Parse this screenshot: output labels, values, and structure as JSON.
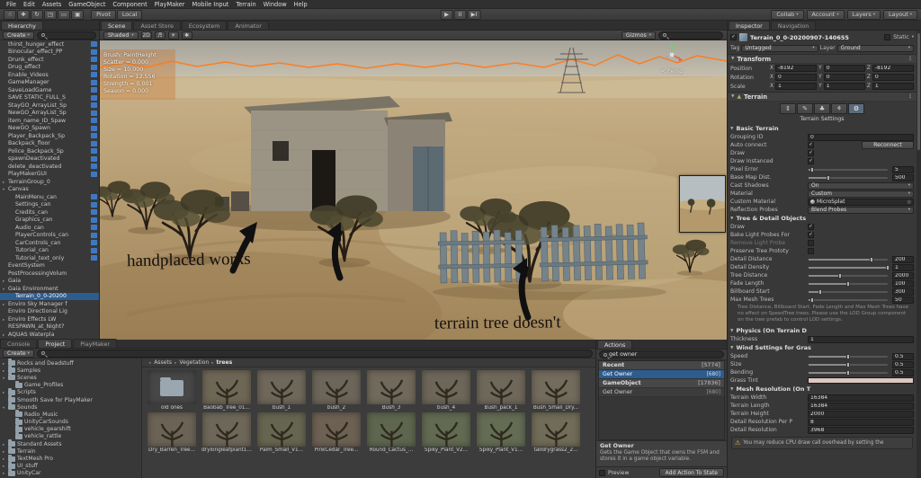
{
  "colors": {
    "selection": "#2d5c8f",
    "badge": "#3d77c2",
    "outline": "#ff7a1c",
    "annotation": "#14110d"
  },
  "menubar": {
    "items": [
      "File",
      "Edit",
      "Assets",
      "GameObject",
      "Component",
      "PlayMaker",
      "Mobile Input",
      "Terrain",
      "Window",
      "Help"
    ]
  },
  "toolbar": {
    "tools": [
      {
        "name": "hand-tool-icon",
        "glyph": "☝"
      },
      {
        "name": "move-tool-icon",
        "glyph": "✚"
      },
      {
        "name": "rotate-tool-icon",
        "glyph": "↻"
      },
      {
        "name": "scale-tool-icon",
        "glyph": "◳"
      },
      {
        "name": "rect-tool-icon",
        "glyph": "▭"
      },
      {
        "name": "transform-tool-icon",
        "glyph": "▣"
      }
    ],
    "pivot": "Pivot",
    "local": "Local",
    "play": "▶",
    "pause": "II",
    "step": "▶I",
    "right": [
      {
        "name": "collab-dropdown",
        "label": "Collab"
      },
      {
        "name": "account-dropdown",
        "label": "Account"
      },
      {
        "name": "layers-dropdown",
        "label": "Layers"
      },
      {
        "name": "layout-dropdown",
        "label": "Layout"
      }
    ]
  },
  "hierarchy": {
    "tab": "Hierarchy",
    "create_label": "Create",
    "items": [
      {
        "label": "thirst_hunger_effect",
        "badge": true
      },
      {
        "label": "Binocular_effect_PP",
        "badge": true
      },
      {
        "label": "Drunk_effect",
        "badge": true
      },
      {
        "label": "Drug_effect",
        "badge": true
      },
      {
        "label": "Enable_Videos",
        "badge": true
      },
      {
        "label": "GameManager",
        "badge": true
      },
      {
        "label": "SaveLoadGame",
        "badge": true
      },
      {
        "label": "SAVE STATIC_FULL_S",
        "badge": true
      },
      {
        "label": "StayGO_ArrayList_Sp",
        "badge": true
      },
      {
        "label": "NewGO_ArrayList_Sp",
        "badge": true
      },
      {
        "label": "item_name_ID_Spaw",
        "badge": true
      },
      {
        "label": "NewGO_Spawn",
        "badge": true
      },
      {
        "label": "Player_Backpack_Sp",
        "badge": true
      },
      {
        "label": "Backpack_floor",
        "badge": true
      },
      {
        "label": "Police_Backpack_Sp",
        "badge": true
      },
      {
        "label": "spawnDeactivated",
        "badge": true
      },
      {
        "label": "delete_deactivated",
        "badge": true
      },
      {
        "label": "PlayMakerGUI",
        "badge": true
      },
      {
        "label": "TerrainGroup_0",
        "arrow": "▸"
      },
      {
        "label": "Canvas",
        "arrow": "▾"
      },
      {
        "label": "MainMenu_can",
        "indent": 1,
        "badge": true
      },
      {
        "label": "Settings_can",
        "indent": 1,
        "badge": true
      },
      {
        "label": "Credits_can",
        "indent": 1,
        "badge": true
      },
      {
        "label": "Graphics_can",
        "indent": 1,
        "badge": true
      },
      {
        "label": "Audio_can",
        "indent": 1,
        "badge": true
      },
      {
        "label": "PlayerControls_can",
        "indent": 1,
        "badge": true
      },
      {
        "label": "CarControls_can",
        "indent": 1,
        "badge": true
      },
      {
        "label": "Tutorial_can",
        "indent": 1,
        "badge": true
      },
      {
        "label": "Tutorial_text_only",
        "indent": 1,
        "badge": true
      },
      {
        "label": "EventSystem"
      },
      {
        "label": "PostProcessingVolum"
      },
      {
        "label": "Gaia",
        "arrow": "▸"
      },
      {
        "label": "Gaia Environment",
        "arrow": "▾"
      },
      {
        "label": "Terrain_0_0-20200",
        "indent": 1,
        "selected": true
      },
      {
        "label": "Enviro Sky Manager f",
        "arrow": "▸"
      },
      {
        "label": "Enviro Directional Lig"
      },
      {
        "label": "Enviro Effects LW",
        "arrow": "▸"
      },
      {
        "label": "RESPAWN_at_Night?"
      },
      {
        "label": "AQUAS Waterpla",
        "arrow": "▸"
      }
    ]
  },
  "scene": {
    "tabs": [
      {
        "name": "tab-scene",
        "label": "Scene",
        "active": true
      },
      {
        "name": "tab-asset-store",
        "label": "Asset Store"
      },
      {
        "name": "tab-ecosystem",
        "label": "Ecosystem"
      },
      {
        "name": "tab-animator",
        "label": "Animator"
      }
    ],
    "shading": "Shaded",
    "d2": "2D",
    "audio_icon": "♬",
    "light_icon": "☀",
    "fx_icon": "✱",
    "gizmos": "Gizmos",
    "brush_lines": [
      "Brush: PaintHeight",
      "Scatter = 0.000",
      "Size = 10.000",
      "Rotation = 12.556",
      "Strength = 0.001",
      "Season = 0.000"
    ],
    "annotation_left": "handplaced works",
    "annotation_right": "terrain tree doesn't",
    "persp_label": "< Persp"
  },
  "bottom_tabs": [
    {
      "name": "tab-console",
      "label": "Console"
    },
    {
      "name": "tab-project",
      "label": "Project",
      "active": true
    },
    {
      "name": "tab-playmaker",
      "label": "PlayMaker"
    }
  ],
  "project": {
    "create_label": "Create",
    "tree": [
      {
        "label": "Rocks and Deadstuff",
        "arrow": "▸"
      },
      {
        "label": "Samples",
        "arrow": "▸"
      },
      {
        "label": "Scenes",
        "arrow": "▾"
      },
      {
        "label": "Game_Profiles",
        "indent": 1
      },
      {
        "label": "Scripts",
        "arrow": "▸"
      },
      {
        "label": "Smooth Save for PlayMaker"
      },
      {
        "label": "Sounds",
        "arrow": "▾"
      },
      {
        "label": "Radio_Music",
        "indent": 1
      },
      {
        "label": "UnityCarSounds",
        "indent": 1
      },
      {
        "label": "vehicle_gearshift",
        "indent": 1
      },
      {
        "label": "vehicle_rattle",
        "indent": 1
      },
      {
        "label": "Standard Assets",
        "arrow": "▸"
      },
      {
        "label": "Terrain",
        "arrow": "▸"
      },
      {
        "label": "TextMesh Pro",
        "arrow": "▸"
      },
      {
        "label": "UI_stuff",
        "arrow": "▸"
      },
      {
        "label": "UnityCar",
        "arrow": "▸"
      }
    ],
    "breadcrumb": [
      "Assets",
      "Vegetation",
      "trees"
    ],
    "items": [
      {
        "label": "old ones",
        "folder": true,
        "tint": "#474747"
      },
      {
        "label": "Baobab_Tree_01...",
        "tint": "#6f6756"
      },
      {
        "label": "bush_1",
        "tint": "#6e675a"
      },
      {
        "label": "bush_2",
        "tint": "#6c655a"
      },
      {
        "label": "Bush_3",
        "tint": "#71695b"
      },
      {
        "label": "bush_4",
        "tint": "#6d6659"
      },
      {
        "label": "Bush_pack_1",
        "tint": "#6f685a"
      },
      {
        "label": "Bush_Small_Dry...",
        "tint": "#736b5c"
      },
      {
        "label": "Dry_Barren_Tree...",
        "tint": "#6b6355"
      },
      {
        "label": "drylongleafplant1...",
        "tint": "#6e6759"
      },
      {
        "label": "Palm_Small_V1...",
        "tint": "#666550"
      },
      {
        "label": "PinkCedar_Tree...",
        "tint": "#6d6153"
      },
      {
        "label": "Round_Cactus_...",
        "tint": "#5e6650"
      },
      {
        "label": "Spiky_Plant_V2...",
        "tint": "#626a52"
      },
      {
        "label": "Spiky_Plant_V1...",
        "tint": "#646c54"
      },
      {
        "label": "talldrygrass2_2...",
        "tint": "#706c57"
      }
    ]
  },
  "actions": {
    "tab": "Actions",
    "search_value": "get owner",
    "rows": [
      {
        "label": "Recent",
        "count": "[5774]",
        "header": true
      },
      {
        "label": "Get Owner",
        "count": "[680]",
        "selected": true
      },
      {
        "label": "GameObject",
        "count": "[17836]",
        "header": true
      },
      {
        "label": "Get Owner",
        "count": "[680]"
      }
    ],
    "desc_title": "Get Owner",
    "desc_body": "Gets the Game Object that owns the FSM and stores it in a game object variable.",
    "preview_label": "Preview",
    "add_button": "Add Action To State"
  },
  "inspector": {
    "tabs": [
      {
        "name": "tab-inspector",
        "label": "Inspector",
        "active": true
      },
      {
        "name": "tab-navigation",
        "label": "Navigation"
      }
    ],
    "header": {
      "name": "Terrain_0_0-20200907-140655",
      "static_label": "Static",
      "tag_label": "Tag",
      "tag": "Untagged",
      "layer_label": "Layer",
      "layer": "Ground"
    },
    "transform": {
      "title": "Transform",
      "axes": [
        "X",
        "Y",
        "Z"
      ],
      "rows": [
        {
          "label": "Position",
          "x": "-8192",
          "y": "0",
          "z": "-8192"
        },
        {
          "label": "Rotation",
          "x": "0",
          "y": "0",
          "z": "0"
        },
        {
          "label": "Scale",
          "x": "1",
          "y": "1",
          "z": "1"
        }
      ]
    },
    "terrain": {
      "title": "Terrain",
      "tools": [
        {
          "name": "raise-lower-terrain-icon",
          "glyph": "⇕"
        },
        {
          "name": "paint-texture-icon",
          "glyph": "✎"
        },
        {
          "name": "paint-trees-icon",
          "glyph": "♣"
        },
        {
          "name": "paint-details-icon",
          "glyph": "⚘"
        },
        {
          "name": "terrain-settings-icon",
          "glyph": "⚙",
          "active": true
        }
      ],
      "tool_caption": "Terrain Settings",
      "basic": {
        "title": "Basic Terrain",
        "rows": [
          {
            "label": "Grouping ID",
            "type": "field",
            "value": "0"
          },
          {
            "label": "Auto connect",
            "type": "toggle",
            "checked": true,
            "button": "Reconnect"
          },
          {
            "label": "Draw",
            "type": "toggle",
            "checked": true
          },
          {
            "label": "Draw Instanced",
            "type": "toggle",
            "checked": true
          },
          {
            "label": "Pixel Error",
            "type": "slider",
            "value": "5",
            "frac": 0.04
          },
          {
            "label": "Base Map Dist.",
            "type": "slider",
            "value": "500",
            "frac": 0.25
          },
          {
            "label": "Cast Shadows",
            "type": "dropdown",
            "value": "On"
          },
          {
            "label": "Material",
            "type": "dropdown",
            "value": "Custom"
          },
          {
            "label": "Custom Material",
            "type": "object",
            "value": "MicroSplat"
          },
          {
            "label": "Reflection Probes",
            "type": "dropdown",
            "value": "Blend Probes"
          }
        ]
      },
      "tree_detail": {
        "title": "Tree & Detail Objects",
        "rows": [
          {
            "label": "Draw",
            "type": "toggle",
            "checked": true
          },
          {
            "label": "Bake Light Probes For",
            "type": "toggle",
            "checked": true
          },
          {
            "label": "Remove Light Probe",
            "type": "toggle",
            "checked": false,
            "dim": true
          },
          {
            "label": "Preserve Tree Prototy",
            "type": "toggle",
            "checked": false
          },
          {
            "label": "Detail Distance",
            "type": "slider",
            "value": "200",
            "frac": 0.8
          },
          {
            "label": "Detail Density",
            "type": "slider",
            "value": "1",
            "frac": 1
          },
          {
            "label": "Tree Distance",
            "type": "slider",
            "value": "2000",
            "frac": 0.4
          },
          {
            "label": "Fade Length",
            "type": "slider",
            "value": "100",
            "frac": 0.5
          },
          {
            "label": "Billboard Start",
            "type": "slider",
            "value": "300",
            "frac": 0.15
          },
          {
            "label": "Max Mesh Trees",
            "type": "slider",
            "value": "50",
            "frac": 0.05
          }
        ],
        "note": "Tree Distance, Billboard Start, Fade Length and Max Mesh Trees have no effect on SpeedTree trees. Please use the LOD Group component on the tree prefab to control LOD settings."
      },
      "physics": {
        "title": "Physics (On Terrain D",
        "rows": [
          {
            "label": "Thickness",
            "type": "field",
            "value": "1"
          }
        ]
      },
      "wind": {
        "title": "Wind Settings for Gras",
        "rows": [
          {
            "label": "Speed",
            "type": "slider",
            "value": "0.5",
            "frac": 0.5
          },
          {
            "label": "Size",
            "type": "slider",
            "value": "0.5",
            "frac": 0.5
          },
          {
            "label": "Bending",
            "type": "slider",
            "value": "0.5",
            "frac": 0.5
          },
          {
            "label": "Grass Tint",
            "type": "color",
            "value": "#dcc8c0"
          }
        ]
      },
      "mesh": {
        "title": "Mesh Resolution (On T",
        "rows": [
          {
            "label": "Terrain Width",
            "type": "field",
            "value": "16384"
          },
          {
            "label": "Terrain Length",
            "type": "field",
            "value": "16384"
          },
          {
            "label": "Terrain Height",
            "type": "field",
            "value": "2000"
          },
          {
            "label": "Detail Resolution Per P",
            "type": "field",
            "value": "8"
          },
          {
            "label": "Detail Resolution",
            "type": "field",
            "value": "3968"
          }
        ]
      }
    },
    "warning": "You may reduce CPU draw call overhead by setting the"
  }
}
